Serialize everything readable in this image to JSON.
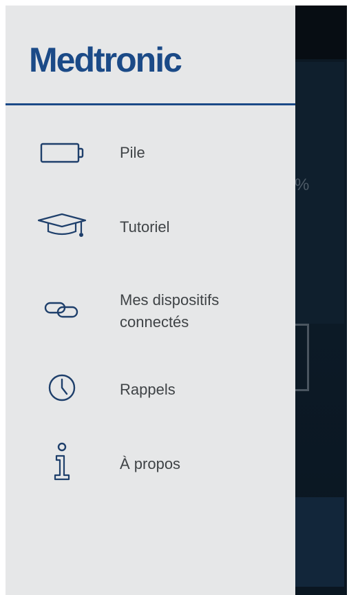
{
  "brand": {
    "logo_text": "Medtronic",
    "color": "#1b4a87"
  },
  "background": {
    "percent_fragment": "%"
  },
  "menu": {
    "items": [
      {
        "label": "Pile",
        "icon": "battery-icon"
      },
      {
        "label": "Tutoriel",
        "icon": "graduation-cap-icon"
      },
      {
        "label": "Mes dispositifs\nconnectés",
        "icon": "link-icon"
      },
      {
        "label": "Rappels",
        "icon": "clock-icon"
      },
      {
        "label": "À propos",
        "icon": "info-icon"
      }
    ]
  },
  "colors": {
    "drawer_bg": "#e6e7e8",
    "icon_color": "#1e3f6b",
    "text_color": "#3f4346"
  }
}
